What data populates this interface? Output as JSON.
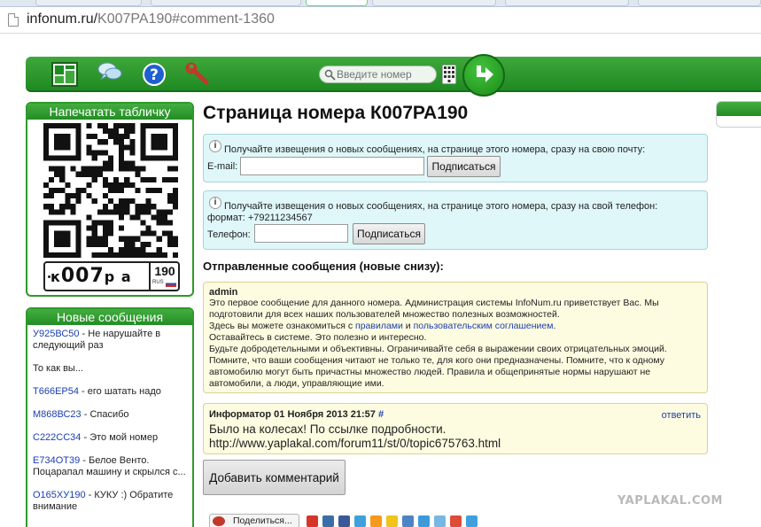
{
  "browser": {
    "url_host": "infonum.ru/",
    "url_path": "K007PA190#comment-1360"
  },
  "topbar": {
    "search_placeholder": "Введите номер",
    "icons": [
      "site-logo-icon",
      "chat-bubbles-icon",
      "help-icon",
      "wrench-icon",
      "keypad-icon",
      "go-arrow-icon"
    ]
  },
  "sidebar": {
    "print_title": "Напечатать табличку",
    "plate": {
      "letter1": "к",
      "digits": "007",
      "letters2": "р а",
      "region": "190",
      "country": "RUS"
    },
    "messages_title": "Новые сообщения",
    "messages": [
      {
        "num": "У925ВС50",
        "text": " - Не нарушайте в следующий раз"
      },
      {
        "num": "",
        "text": "То как вы..."
      },
      {
        "num": "Т666ЕР54",
        "text": " - его шатать надо"
      },
      {
        "num": "М868ВС23",
        "text": " - Спасибо"
      },
      {
        "num": "С222СС34",
        "text": " - Это мой номер"
      },
      {
        "num": "Е734ОТ39",
        "text": " - Белое Венто. Поцарапал машину и скрылся с..."
      },
      {
        "num": "О165ХУ190",
        "text": " - КУКУ :) Обратите внимание"
      }
    ]
  },
  "main": {
    "title": "Страница номера К007РА190",
    "email_notice": "Получайте извещения о новых сообщениях, на странице этого номера, сразу на свою почту:",
    "email_label": "E-mail:",
    "subscribe_label": "Подписаться",
    "phone_notice": "Получайте извещения о новых сообщениях, на странице этого номера, сразу на свой телефон:",
    "phone_format": "формат: +79211234567",
    "phone_label": "Телефон:",
    "sent_header": "Отправленные сообщения (новые снизу):",
    "admin": {
      "author": "admin",
      "lines": [
        "Это первое сообщение для данного номера. Администрация системы InfoNum.ru приветствует Вас. Мы",
        "подготовили для всех наших пользователей множество полезных возможностей."
      ],
      "line3_before": "Здесь вы можете ознакомиться с ",
      "rules_link": "правилами",
      "line3_mid": " и ",
      "agreement_link": "пользовательским соглашением",
      "line3_after": ".",
      "lines_after": [
        "Оставайтесь в системе. Это полезно и интересно.",
        "Будьте добродетельными и объективны. Ограничивайте себя в выражении своих отрицательных эмоций.",
        "Помните, что ваши сообщения читают не только те, для кого они предназначены. Помните, что к одному",
        "автомобилю могут быть причастны множество людей. Правила и общепринятые нормы нарушают не",
        "автомобили, а люди, управляющие ими."
      ]
    },
    "comment2": {
      "author": "Информатор 01 Ноября 2013 21:57",
      "hash": "#",
      "reply": "ответить",
      "line1": "Было на колесах! По ссылке подробности.",
      "line2": "http://www.yaplakal.com/forum11/st/0/topic675763.html"
    },
    "add_comment": "Добавить комментарий",
    "share_label": "Поделиться..."
  },
  "social_colors": [
    "#d8352a",
    "#3b6ea8",
    "#3b5998",
    "#3ea1dd",
    "#f59a1b",
    "#f0c419",
    "#4d84c4",
    "#3b9ad9",
    "#79b7e3",
    "#dd4b39",
    "#3ea1dd"
  ],
  "watermark": "YAPLAKAL.COM"
}
